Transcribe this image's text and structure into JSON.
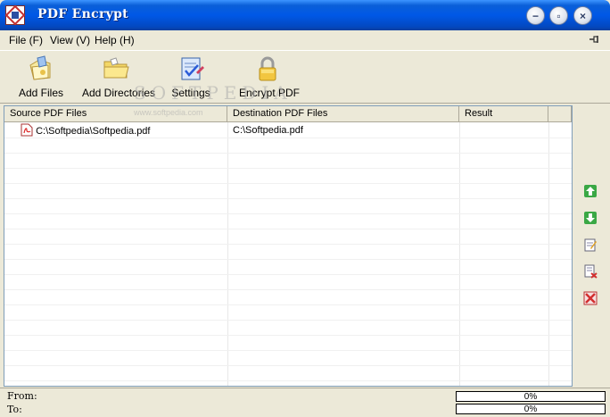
{
  "window": {
    "title": "PDF Encrypt",
    "controls": {
      "minimize": "−",
      "restore": "▫",
      "close": "×"
    }
  },
  "menu": [
    {
      "label": "File (F)"
    },
    {
      "label": "View (V)"
    },
    {
      "label": "Help (H)"
    }
  ],
  "toolbar": [
    {
      "label": "Add Files",
      "icon": "add-files-icon"
    },
    {
      "label": "Add Directories",
      "icon": "folder-icon"
    },
    {
      "label": "Settings",
      "icon": "settings-icon"
    },
    {
      "label": "Encrypt PDF",
      "icon": "lock-icon"
    }
  ],
  "table": {
    "columns": [
      "Source PDF Files",
      "Destination PDF Files",
      "Result"
    ],
    "rows": [
      {
        "source": "C:\\Softpedia\\Softpedia.pdf",
        "destination": "C:\\Softpedia.pdf",
        "result": ""
      }
    ]
  },
  "side_buttons": [
    {
      "icon": "move-up-icon"
    },
    {
      "icon": "move-down-icon"
    },
    {
      "icon": "edit-icon"
    },
    {
      "icon": "remove-file-icon"
    },
    {
      "icon": "clear-all-icon"
    }
  ],
  "status": {
    "from_label": "From:",
    "to_label": "To:",
    "from_progress": "0%",
    "to_progress": "0%",
    "from_value": 0,
    "to_value": 0
  },
  "watermark": {
    "main": "SOFTPEDIA",
    "sub": "www.softpedia.com"
  },
  "colors": {
    "titlebar": "#0058e6",
    "window_bg": "#ece9d8",
    "accent_green": "#2e9a2e",
    "accent_red": "#d32f2f"
  }
}
